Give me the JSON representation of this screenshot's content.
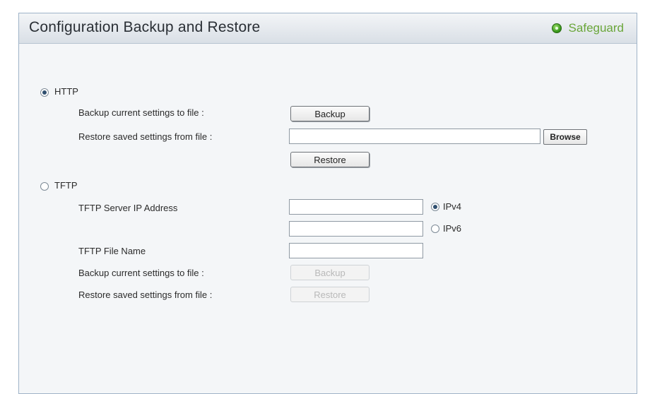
{
  "header": {
    "title": "Configuration Backup and Restore",
    "status_label": "Safeguard",
    "status_color": "#2f8f14"
  },
  "http": {
    "label": "HTTP",
    "selected": true,
    "backup_label": "Backup current settings to file :",
    "backup_button": "Backup",
    "restore_label": "Restore saved settings from file :",
    "file_value": "",
    "browse_button": "Browse",
    "restore_button": "Restore"
  },
  "tftp": {
    "label": "TFTP",
    "selected": false,
    "server_ip_label": "TFTP Server IP Address",
    "ipv4_value": "",
    "ipv4_label": "IPv4",
    "ipv4_selected": true,
    "ipv6_value": "",
    "ipv6_label": "IPv6",
    "ipv6_selected": false,
    "file_name_label": "TFTP File Name",
    "file_name_value": "",
    "backup_label": "Backup current settings to file :",
    "backup_button": "Backup",
    "restore_label": "Restore saved settings from file :",
    "restore_button": "Restore"
  }
}
